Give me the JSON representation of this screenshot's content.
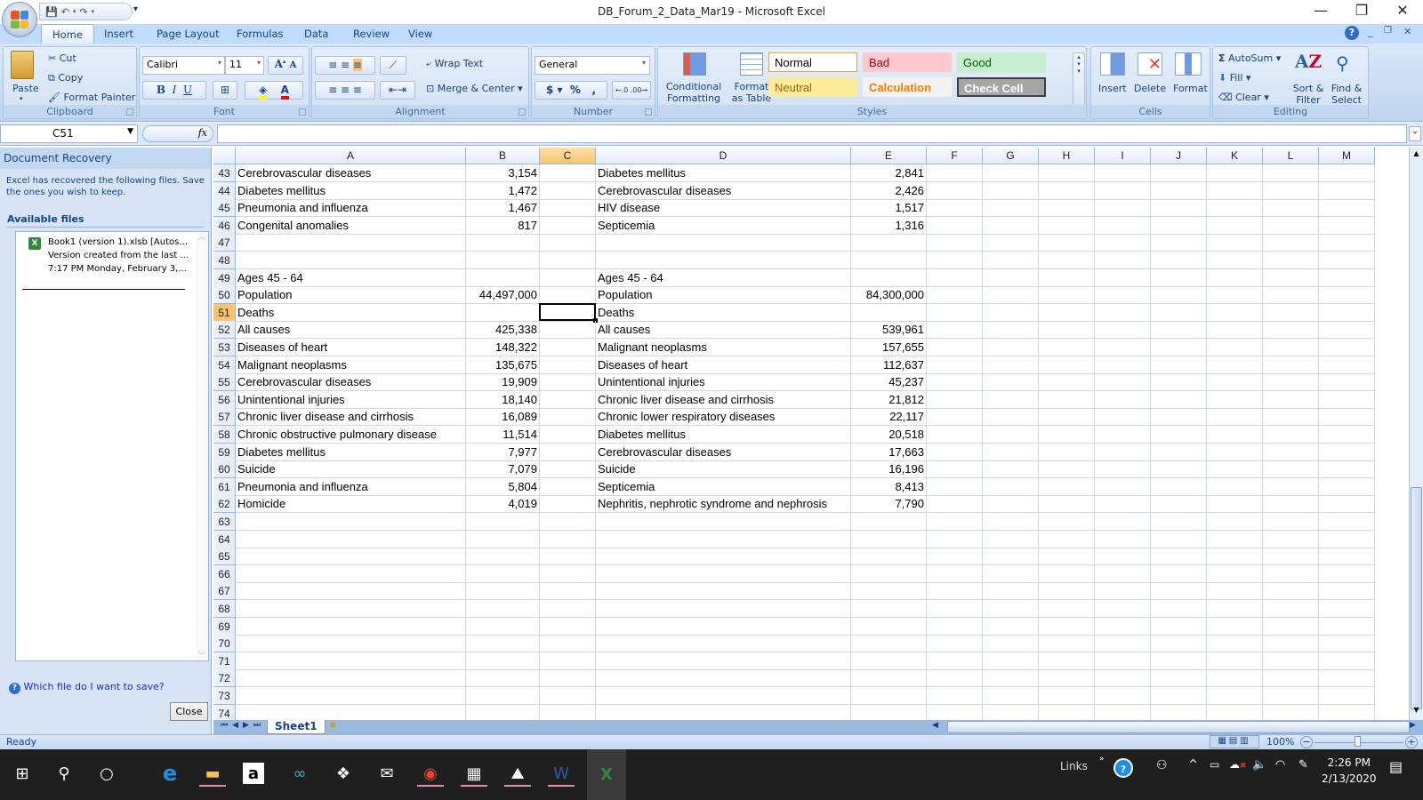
{
  "window": {
    "title": "DB_Forum_2_Data_Mar19 - Microsoft Excel",
    "controls": {
      "minimize": "—",
      "restore": "❐",
      "close": "✕"
    }
  },
  "quick_access": {
    "save": "💾",
    "undo": "↶",
    "redo": "↷"
  },
  "ribbon_tabs": [
    "Home",
    "Insert",
    "Page Layout",
    "Formulas",
    "Data",
    "Review",
    "View"
  ],
  "active_tab": "Home",
  "ribbon": {
    "clipboard": {
      "label": "Clipboard",
      "paste": "Paste",
      "cut": "Cut",
      "copy": "Copy",
      "format_painter": "Format Painter"
    },
    "font": {
      "label": "Font",
      "font_name": "Calibri",
      "font_size": "11",
      "bold": "B",
      "italic": "I",
      "underline": "U",
      "fill_color": "#ffff00",
      "font_color": "#ff0000"
    },
    "alignment": {
      "label": "Alignment",
      "wrap_text": "Wrap Text",
      "merge_center": "Merge & Center"
    },
    "number": {
      "label": "Number",
      "format": "General",
      "currency": "$",
      "percent": "%",
      "comma": ","
    },
    "styles": {
      "label": "Styles",
      "conditional_formatting": "Conditional Formatting",
      "format_as_table": "Format as Table",
      "cells": [
        {
          "name": "Normal",
          "bg": "#ffffff",
          "fg": "#000000"
        },
        {
          "name": "Bad",
          "bg": "#ffc7ce",
          "fg": "#9c0006"
        },
        {
          "name": "Good",
          "bg": "#c6efce",
          "fg": "#006100"
        },
        {
          "name": "Neutral",
          "bg": "#ffeb9c",
          "fg": "#9c6500"
        },
        {
          "name": "Calculation",
          "bg": "#f2f2f2",
          "fg": "#fa7d00"
        },
        {
          "name": "Check Cell",
          "bg": "#a5a5a5",
          "fg": "#ffffff"
        }
      ]
    },
    "cells": {
      "label": "Cells",
      "insert": "Insert",
      "delete": "Delete",
      "format": "Format"
    },
    "editing": {
      "label": "Editing",
      "autosum": "AutoSum",
      "fill": "Fill",
      "clear": "Clear",
      "sort_filter": "Sort & Filter",
      "find_select": "Find & Select"
    }
  },
  "formula_bar": {
    "name_box": "C51",
    "fx": "fx",
    "formula": ""
  },
  "recovery": {
    "title": "Document Recovery",
    "description": "Excel has recovered the following files.  Save the ones you wish to keep.",
    "available_label": "Available files",
    "file": {
      "name": "Book1 (version 1).xlsb  [Autos...",
      "desc": "Version created from the last ...",
      "time": "7:17 PM Monday, February 3,..."
    },
    "help_link": "Which file do I want to save?",
    "close": "Close"
  },
  "sheet": {
    "columns": [
      "A",
      "B",
      "C",
      "D",
      "E",
      "F",
      "G",
      "H",
      "I",
      "J",
      "K",
      "L",
      "M"
    ],
    "selected_column": "C",
    "selected_row": "51",
    "active_cell": "C51",
    "rows": [
      {
        "n": "43",
        "A": "Cerebrovascular diseases",
        "B": "3,154",
        "D": "Diabetes mellitus",
        "E": "2,841"
      },
      {
        "n": "44",
        "A": "Diabetes mellitus",
        "B": "1,472",
        "D": "Cerebrovascular diseases",
        "E": "2,426"
      },
      {
        "n": "45",
        "A": "Pneumonia and influenza",
        "B": "1,467",
        "D": "HIV disease",
        "E": "1,517"
      },
      {
        "n": "46",
        "A": "Congenital anomalies",
        "B": "817",
        "D": "Septicemia",
        "E": "1,316"
      },
      {
        "n": "47",
        "A": "",
        "B": "",
        "D": "",
        "E": ""
      },
      {
        "n": "48",
        "A": "",
        "B": "",
        "D": "",
        "E": ""
      },
      {
        "n": "49",
        "A": "Ages 45 - 64",
        "B": "",
        "D": "Ages 45 - 64",
        "E": ""
      },
      {
        "n": "50",
        "A": "Population",
        "B": "44,497,000",
        "D": "Population",
        "E": "84,300,000"
      },
      {
        "n": "51",
        "A": "Deaths",
        "B": "",
        "D": "Deaths",
        "E": ""
      },
      {
        "n": "52",
        "A": "All causes",
        "B": "425,338",
        "D": "All causes",
        "E": "539,961"
      },
      {
        "n": "53",
        "A": "Diseases of heart",
        "B": "148,322",
        "D": "Malignant neoplasms",
        "E": "157,655"
      },
      {
        "n": "54",
        "A": "Malignant neoplasms",
        "B": "135,675",
        "D": "Diseases of heart",
        "E": "112,637"
      },
      {
        "n": "55",
        "A": "Cerebrovascular diseases",
        "B": "19,909",
        "D": "Unintentional injuries",
        "E": "45,237"
      },
      {
        "n": "56",
        "A": "Unintentional injuries",
        "B": "18,140",
        "D": "Chronic liver disease and cirrhosis",
        "E": "21,812"
      },
      {
        "n": "57",
        "A": "Chronic liver disease and cirrhosis",
        "B": "16,089",
        "D": "Chronic lower respiratory diseases",
        "E": "22,117"
      },
      {
        "n": "58",
        "A": "Chronic obstructive pulmonary disease",
        "B": "11,514",
        "D": "Diabetes mellitus",
        "E": "20,518"
      },
      {
        "n": "59",
        "A": "Diabetes mellitus",
        "B": "7,977",
        "D": "Cerebrovascular diseases",
        "E": "17,663"
      },
      {
        "n": "60",
        "A": "Suicide",
        "B": "7,079",
        "D": "Suicide",
        "E": "16,196"
      },
      {
        "n": "61",
        "A": "Pneumonia and influenza",
        "B": "5,804",
        "D": "Septicemia",
        "E": "8,413"
      },
      {
        "n": "62",
        "A": "Homicide",
        "B": "4,019",
        "D": "Nephritis, nephrotic syndrome and nephrosis",
        "E": "7,790"
      },
      {
        "n": "63"
      },
      {
        "n": "64"
      },
      {
        "n": "65"
      },
      {
        "n": "66"
      },
      {
        "n": "67"
      },
      {
        "n": "68"
      },
      {
        "n": "69"
      },
      {
        "n": "70"
      },
      {
        "n": "71"
      },
      {
        "n": "72"
      },
      {
        "n": "73"
      },
      {
        "n": "74"
      }
    ],
    "sheet_tabs": [
      "Sheet1"
    ]
  },
  "status": {
    "text": "Ready",
    "zoom": "100%"
  },
  "taskbar": {
    "apps": [
      "windows-start",
      "search",
      "cortana",
      "edge",
      "file-explorer",
      "amazon",
      "infinity",
      "dropbox",
      "mail",
      "chrome",
      "calculator",
      "photos",
      "word",
      "excel"
    ],
    "links_label": "Links",
    "time": "2:26 PM",
    "date": "2/13/2020"
  }
}
